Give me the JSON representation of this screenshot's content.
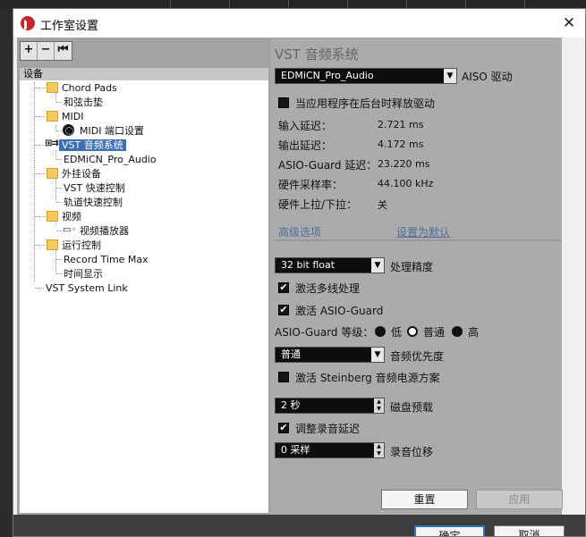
{
  "window": {
    "title": "工作室设置"
  },
  "toolbar": {
    "add": "+",
    "remove": "−",
    "reset": "⏮"
  },
  "tree": {
    "header": "设备",
    "items": [
      {
        "label": "Chord Pads"
      },
      {
        "label": "和弦击垫"
      },
      {
        "label": "MIDI"
      },
      {
        "label": "MIDI 端口设置"
      },
      {
        "label": "VST 音频系统"
      },
      {
        "label": "EDMiCN_Pro_Audio"
      },
      {
        "label": "外挂设备"
      },
      {
        "label": "VST 快速控制"
      },
      {
        "label": "轨道快速控制"
      },
      {
        "label": "视频"
      },
      {
        "label": "视频播放器"
      },
      {
        "label": "运行控制"
      },
      {
        "label": "Record Time Max"
      },
      {
        "label": "时间显示"
      },
      {
        "label": "VST System Link"
      }
    ]
  },
  "panel": {
    "title": "VST 音频系统",
    "driver": {
      "value": "EDMiCN_Pro_Audio",
      "label": "AISO 驱动"
    },
    "release_driver": "当应用程序在后台时释放驱动",
    "info": [
      {
        "label": "输入延迟：",
        "value": "2.721 ms"
      },
      {
        "label": "输出延迟：",
        "value": "4.172 ms"
      },
      {
        "label": "ASIO-Guard 延迟：",
        "value": "23.220 ms"
      },
      {
        "label": "硬件采样率：",
        "value": "44.100 kHz"
      },
      {
        "label": "硬件上拉/下拉：",
        "value": "关"
      }
    ],
    "advanced_label": "高级选项",
    "set_default_label": "设置为默认",
    "precision": {
      "value": "32 bit float",
      "label": "处理精度"
    },
    "multiprocessing": "激活多线处理",
    "asio_guard": "激活 ASIO-Guard",
    "asio_level": {
      "label": "ASIO-Guard 等级：",
      "options": [
        "低",
        "普通",
        "高"
      ]
    },
    "priority": {
      "value": "普通",
      "label": "音频优先度"
    },
    "steinberg_power": "激活 Steinberg 音频电源方案",
    "preload": {
      "value": "2 秒",
      "label": "磁盘预载"
    },
    "adjust_latency": "调整录音延迟",
    "record_shift": {
      "value": "0 采样",
      "label": "录音位移"
    },
    "reset_btn": "重置",
    "apply_btn": "应用"
  },
  "footer": {
    "ok": "确定",
    "cancel": "取消"
  }
}
